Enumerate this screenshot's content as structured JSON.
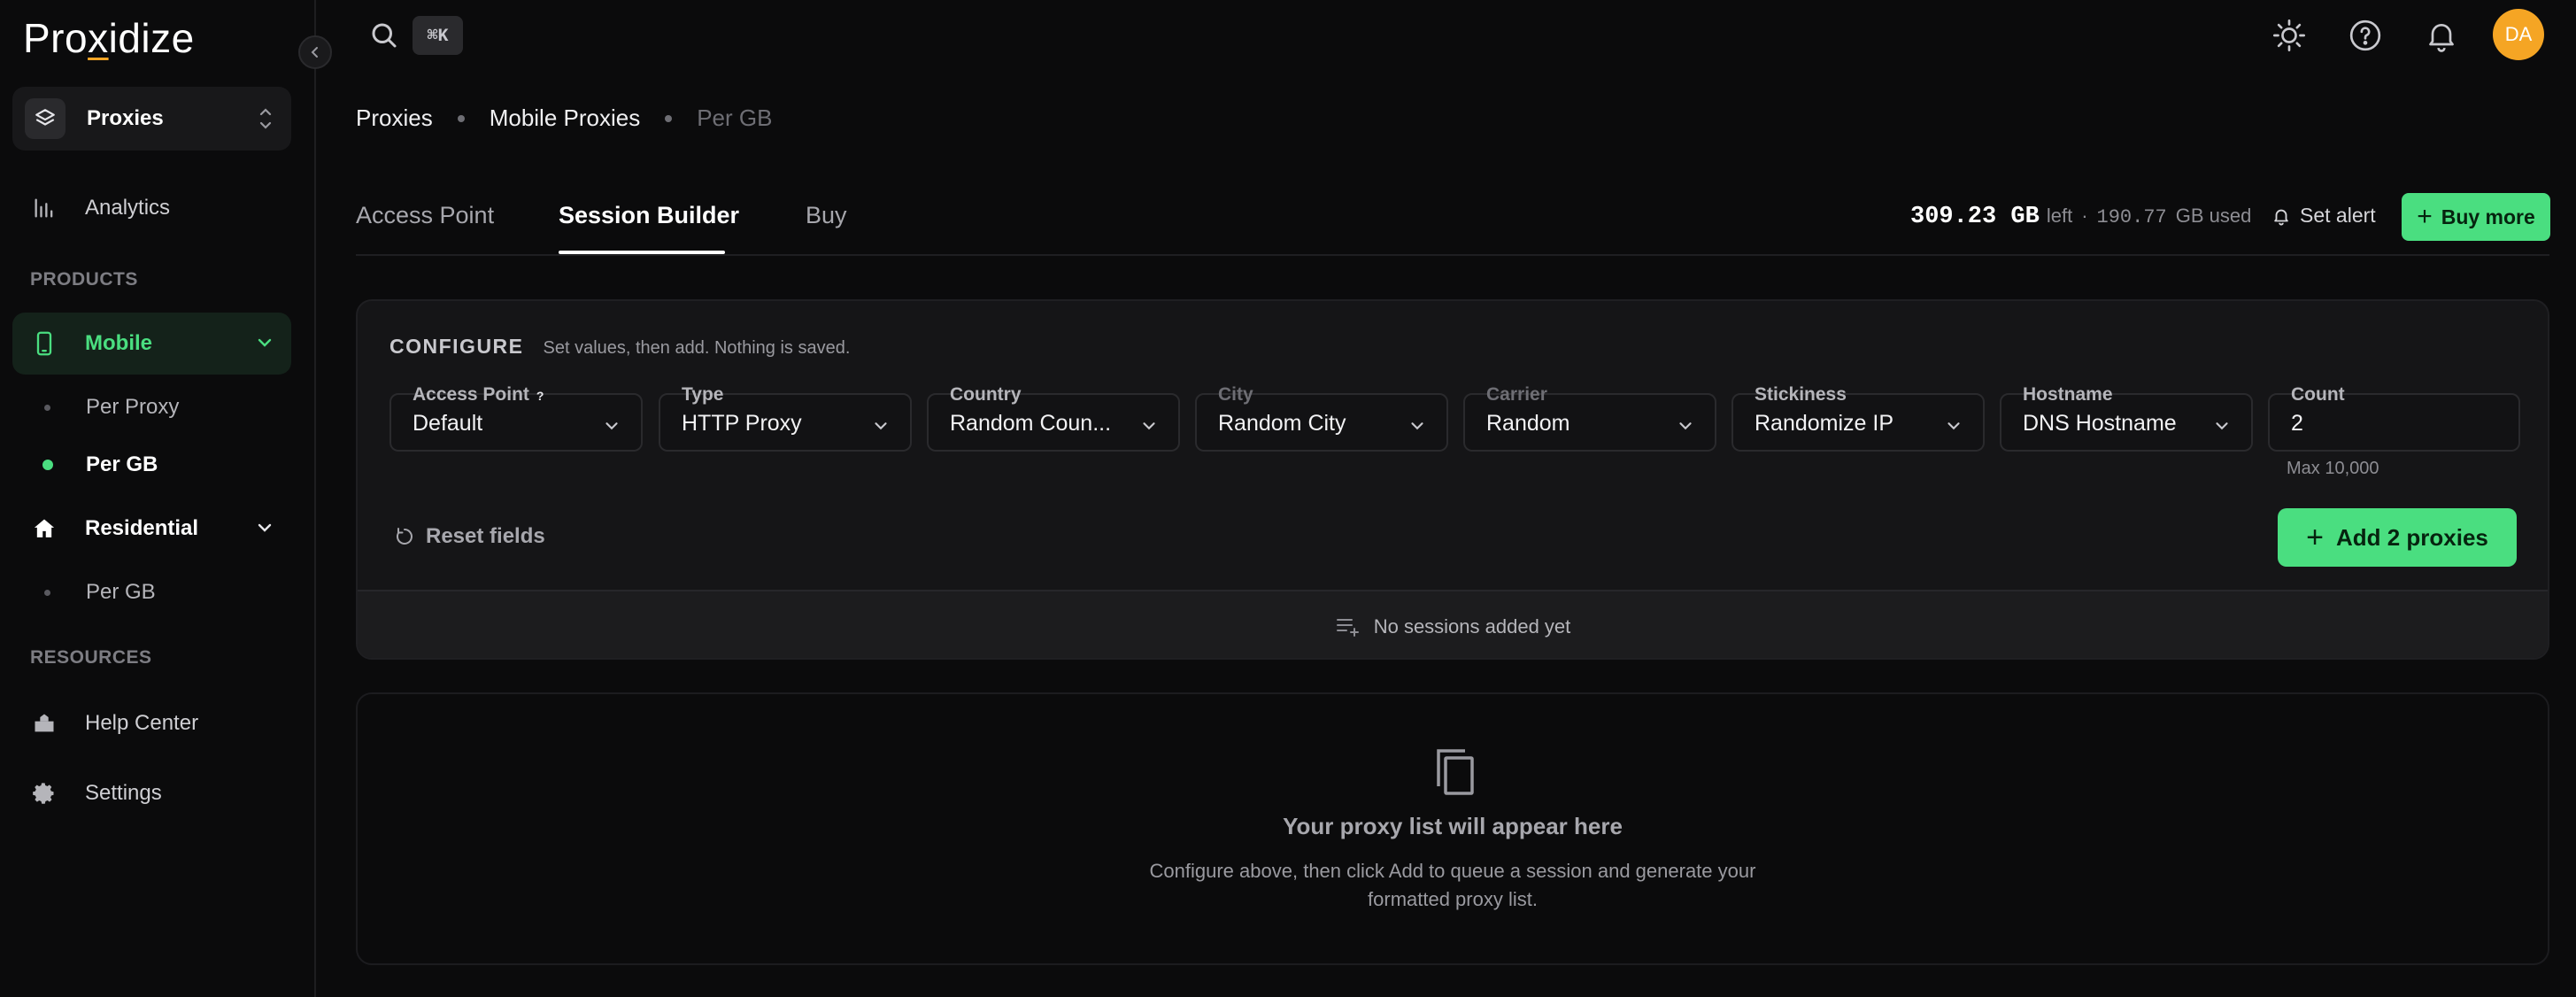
{
  "brand": {
    "logo_pre": "Pro",
    "logo_u": "x",
    "logo_post": "idize"
  },
  "sidebar": {
    "project": "Proxies",
    "analytics": "Analytics",
    "products_section": "PRODUCTS",
    "mobile": "Mobile",
    "mobile_items": [
      "Per Proxy",
      "Per GB"
    ],
    "residential": "Residential",
    "residential_items": [
      "Per GB"
    ],
    "resources_section": "RESOURCES",
    "help": "Help Center",
    "settings": "Settings"
  },
  "topbar": {
    "shortcut": "⌘K",
    "avatar": "DA"
  },
  "breadcrumb": [
    "Proxies",
    "Mobile Proxies",
    "Per GB"
  ],
  "tabs": [
    "Access Point",
    "Session Builder",
    "Buy"
  ],
  "active_tab": "Session Builder",
  "usage": {
    "left_value": "309.23 GB",
    "left_label": "left",
    "sep": "·",
    "used_value": "190.77",
    "used_label": "GB used"
  },
  "actions": {
    "set_alert": "Set alert",
    "buy_more": "Buy more"
  },
  "configure": {
    "title": "CONFIGURE",
    "subtitle": "Set values, then add. Nothing is saved.",
    "fields": [
      {
        "label": "Access Point",
        "value": "Default",
        "help": "?"
      },
      {
        "label": "Type",
        "value": "HTTP Proxy"
      },
      {
        "label": "Country",
        "value": "Random Coun..."
      },
      {
        "label": "City",
        "value": "Random City"
      },
      {
        "label": "Carrier",
        "value": "Random"
      },
      {
        "label": "Stickiness",
        "value": "Randomize IP"
      },
      {
        "label": "Hostname",
        "value": "DNS Hostname"
      },
      {
        "label": "Count",
        "value": "2"
      }
    ],
    "count_note": "Max 10,000",
    "reset": "Reset fields",
    "add": "Add 2 proxies",
    "no_sessions": "No sessions added yet"
  },
  "proxy_list": {
    "title": "Your proxy list will appear here",
    "subtitle": "Configure above, then click Add to queue a session and generate your formatted proxy list."
  },
  "colors": {
    "accent": "#4ade80",
    "avatar": "#f5a524",
    "bg": "#0b0b0c"
  }
}
